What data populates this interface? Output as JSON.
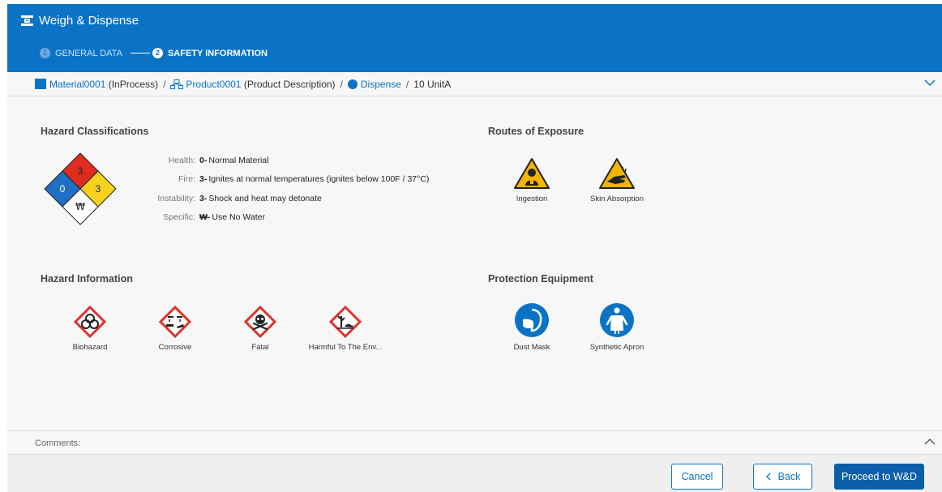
{
  "app": {
    "title": "Weigh & Dispense"
  },
  "steps": [
    {
      "number": "1",
      "label": "GENERAL DATA",
      "state": "inactive"
    },
    {
      "number": "2",
      "label": "SAFETY INFORMATION",
      "state": "active"
    }
  ],
  "breadcrumb": {
    "material": "Material0001",
    "material_status": "(InProcess)",
    "product": "Product0001",
    "product_description": "(Product Description)",
    "operation": "Dispense",
    "quantity": "10 UnitA",
    "separator": "/"
  },
  "hazard_classifications": {
    "title": "Hazard Classifications",
    "nfpa": {
      "health": "0",
      "fire": "3",
      "instability": "3",
      "specific": "₩"
    },
    "rows": [
      {
        "label": "Health:",
        "value": "0-",
        "text": "Normal Material"
      },
      {
        "label": "Fire:",
        "value": "3-",
        "text": "Ignites at normal temperatures (ignites below 100F / 37°C)"
      },
      {
        "label": "Instability:",
        "value": "3-",
        "text": "Shock and heat may detonate"
      },
      {
        "label": "Specific:",
        "value": "₩-",
        "text": "Use No Water"
      }
    ]
  },
  "routes_of_exposure": {
    "title": "Routes of Exposure",
    "items": [
      {
        "label": "Ingestion",
        "icon": "ingestion-warning-icon"
      },
      {
        "label": "Skin Absorption",
        "icon": "skin-absorption-warning-icon"
      }
    ]
  },
  "hazard_information": {
    "title": "Hazard Information",
    "items": [
      {
        "label": "Biohazard",
        "icon": "biohazard-icon"
      },
      {
        "label": "Corrosive",
        "icon": "corrosive-icon"
      },
      {
        "label": "Fatal",
        "icon": "skull-crossbones-icon"
      },
      {
        "label": "Harmful To The Env...",
        "icon": "environment-hazard-icon"
      }
    ]
  },
  "protection_equipment": {
    "title": "Protection Equipment",
    "items": [
      {
        "label": "Dust Mask",
        "icon": "dust-mask-icon"
      },
      {
        "label": "Synthetic Apron",
        "icon": "apron-icon"
      }
    ]
  },
  "comments": {
    "label": "Comments:"
  },
  "footer": {
    "cancel_label": "Cancel",
    "back_label": "Back",
    "proceed_label": "Proceed to W&D"
  },
  "colors": {
    "header_blue": "#0a73c6",
    "primary_button": "#0b5fa8",
    "nfpa_health": "#1f6fc5",
    "nfpa_fire": "#e02b20",
    "nfpa_instability": "#f6d21e",
    "ghs_red": "#e0322b",
    "warning_yellow": "#f4b400"
  }
}
